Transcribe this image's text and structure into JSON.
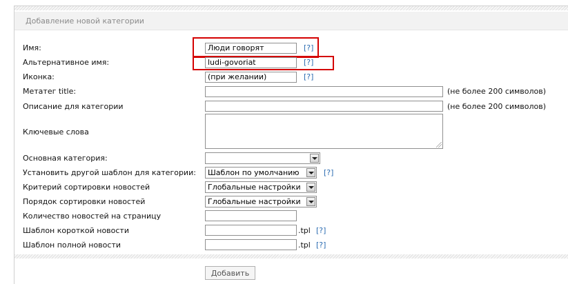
{
  "header": {
    "title": "Добавление новой категории"
  },
  "form": {
    "name": {
      "label": "Имя:",
      "value": "Люди говорят",
      "help": "[?]"
    },
    "alt_name": {
      "label": "Альтернативное имя:",
      "value": "ludi-govoriat",
      "help": "[?]"
    },
    "icon": {
      "label": "Иконка:",
      "value": "(при желании)",
      "help": "[?]"
    },
    "meta_title": {
      "label": "Метатег title:",
      "value": "",
      "note": "(не более 200 символов)"
    },
    "description": {
      "label": "Описание для категории",
      "value": "",
      "note": "(не более 200 символов)"
    },
    "keywords": {
      "label": "Ключевые слова",
      "value": ""
    },
    "parent": {
      "label": "Основная категория:",
      "value": ""
    },
    "template": {
      "label": "Установить другой шаблон для категории:",
      "value": "Шаблон по умолчанию",
      "help": "[?]"
    },
    "sort_criterion": {
      "label": "Критерий сортировки новостей",
      "value": "Глобальные настройки"
    },
    "sort_order": {
      "label": "Порядок сортировки новостей",
      "value": "Глобальные настройки"
    },
    "news_per_page": {
      "label": "Количество новостей на страницу",
      "value": ""
    },
    "short_template": {
      "label": "Шаблон короткой новости",
      "value": "",
      "suffix": ".tpl",
      "help": "[?]"
    },
    "full_template": {
      "label": "Шаблон полной новости",
      "value": "",
      "suffix": ".tpl",
      "help": "[?]"
    }
  },
  "footer": {
    "submit_label": "Добавить"
  },
  "colors": {
    "highlight": "#d40000",
    "help_link": "#2a6bb1",
    "header_text": "#8a8a8a"
  }
}
